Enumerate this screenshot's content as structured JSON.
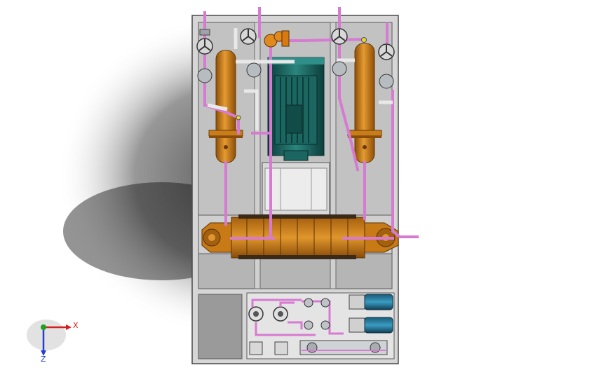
{
  "triad": {
    "x_label": "X",
    "z_label": "Z",
    "x_color": "#d32020",
    "y_color": "#20a020",
    "z_color": "#2040d0"
  },
  "colors": {
    "frame": "#d9d9d9",
    "frame_edge": "#5a5a5a",
    "vessel": "#d98a1e",
    "vessel_dark": "#9a5a0c",
    "pipe": "#d77ad2",
    "motor": "#1f6f6a",
    "motor_dark": "#0f4a46",
    "valve_body": "#bfc3c7",
    "pump_blue": "#1f6f8f"
  },
  "icons": {
    "gauge": "pressure-gauge-icon",
    "valve": "valve-handwheel-icon",
    "triad": "coordinate-triad-icon"
  }
}
